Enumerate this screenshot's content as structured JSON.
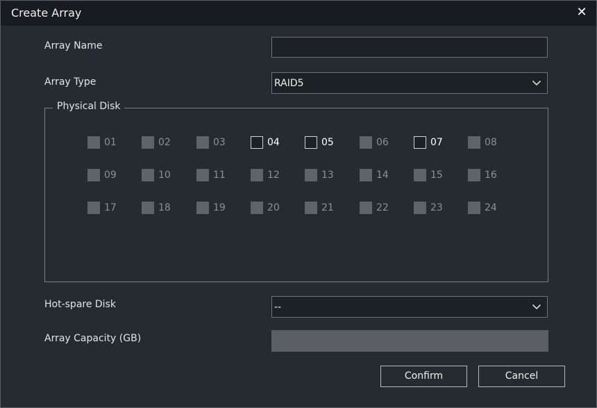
{
  "dialog": {
    "title": "Create Array",
    "close_icon": "close-icon"
  },
  "array_name": {
    "label": "Array Name",
    "value": ""
  },
  "array_type": {
    "label": "Array Type",
    "selected": "RAID5",
    "icon": "chevron-down-icon"
  },
  "physical_disk": {
    "legend": "Physical Disk",
    "disks": [
      {
        "id": "01",
        "enabled": false
      },
      {
        "id": "02",
        "enabled": false
      },
      {
        "id": "03",
        "enabled": false
      },
      {
        "id": "04",
        "enabled": true
      },
      {
        "id": "05",
        "enabled": true
      },
      {
        "id": "06",
        "enabled": false
      },
      {
        "id": "07",
        "enabled": true
      },
      {
        "id": "08",
        "enabled": false
      },
      {
        "id": "09",
        "enabled": false
      },
      {
        "id": "10",
        "enabled": false
      },
      {
        "id": "11",
        "enabled": false
      },
      {
        "id": "12",
        "enabled": false
      },
      {
        "id": "13",
        "enabled": false
      },
      {
        "id": "14",
        "enabled": false
      },
      {
        "id": "15",
        "enabled": false
      },
      {
        "id": "16",
        "enabled": false
      },
      {
        "id": "17",
        "enabled": false
      },
      {
        "id": "18",
        "enabled": false
      },
      {
        "id": "19",
        "enabled": false
      },
      {
        "id": "20",
        "enabled": false
      },
      {
        "id": "21",
        "enabled": false
      },
      {
        "id": "22",
        "enabled": false
      },
      {
        "id": "23",
        "enabled": false
      },
      {
        "id": "24",
        "enabled": false
      }
    ]
  },
  "hot_spare": {
    "label": "Hot-spare Disk",
    "selected": "--",
    "icon": "chevron-down-icon"
  },
  "capacity": {
    "label": "Array Capacity (GB)",
    "value": ""
  },
  "buttons": {
    "confirm": "Confirm",
    "cancel": "Cancel"
  },
  "colors": {
    "background": "#262b31",
    "titlebar": "#181b1f",
    "input_bg": "#1d2024",
    "disabled_box": "#5f6368",
    "capacity_bg": "#5b5f63"
  }
}
